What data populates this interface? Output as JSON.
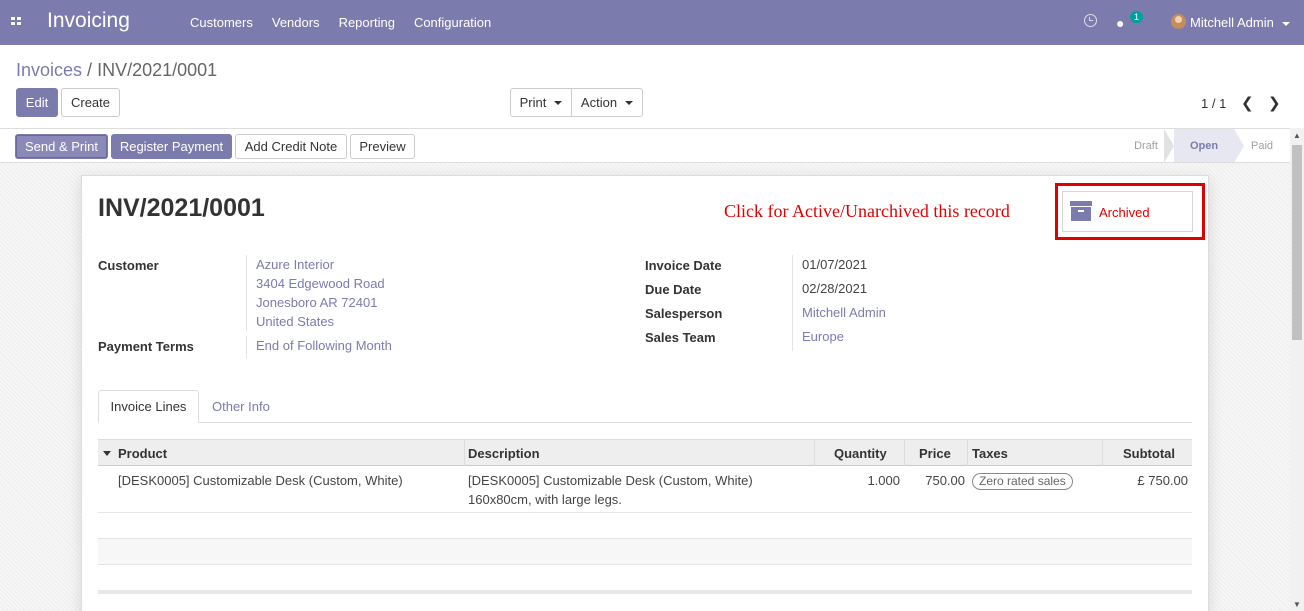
{
  "navbar": {
    "app_name": "Invoicing",
    "menu": [
      "Customers",
      "Vendors",
      "Reporting",
      "Configuration"
    ],
    "chat_count": "1",
    "user_name": "Mitchell Admin",
    "brand_color": "#7c7bad"
  },
  "control_panel": {
    "breadcrumb_parent": "Invoices",
    "breadcrumb_sep": " / ",
    "breadcrumb_current": "INV/2021/0001",
    "edit_label": "Edit",
    "create_label": "Create",
    "print_label": "Print",
    "action_label": "Action",
    "pager": "1 / 1"
  },
  "statusbar": {
    "buttons": [
      "Send & Print",
      "Register Payment",
      "Add Credit Note",
      "Preview"
    ],
    "stages": [
      "Draft",
      "Open",
      "Paid"
    ],
    "active_stage": "Open"
  },
  "form": {
    "title": "INV/2021/0001",
    "annotation": "Click for Active/Unarchived this record",
    "archived_label": "Archived",
    "customer_label": "Customer",
    "customer_lines": [
      "Azure Interior",
      "3404 Edgewood Road",
      "Jonesboro AR 72401",
      "United States"
    ],
    "payment_terms_label": "Payment Terms",
    "payment_terms": "End of Following Month",
    "invoice_date_label": "Invoice Date",
    "invoice_date": "01/07/2021",
    "due_date_label": "Due Date",
    "due_date": "02/28/2021",
    "salesperson_label": "Salesperson",
    "salesperson": "Mitchell Admin",
    "sales_team_label": "Sales Team",
    "sales_team": "Europe"
  },
  "tabs": [
    "Invoice Lines",
    "Other Info"
  ],
  "table": {
    "columns": [
      "Product",
      "Description",
      "Quantity",
      "Price",
      "Taxes",
      "Subtotal"
    ],
    "rows": [
      {
        "product": "[DESK0005] Customizable Desk (Custom, White)",
        "description_1": "[DESK0005] Customizable Desk (Custom, White)",
        "description_2": "160x80cm, with large legs.",
        "quantity": "1.000",
        "price": "750.00",
        "taxes": "Zero rated sales",
        "subtotal": "£ 750.00"
      }
    ]
  },
  "icons": [
    "apps-icon",
    "clock-icon",
    "chat-icon",
    "archive-icon",
    "chevron-left-icon",
    "chevron-right-icon",
    "sort-caret-icon"
  ]
}
